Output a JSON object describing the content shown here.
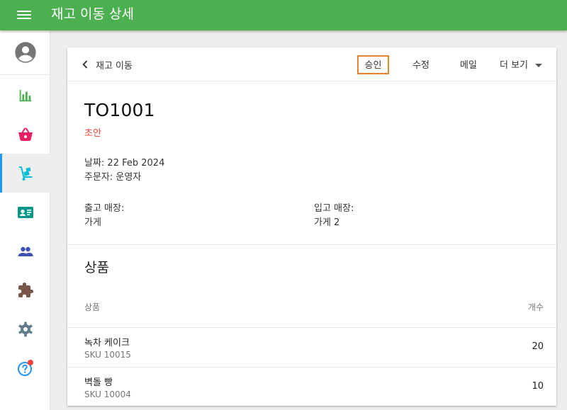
{
  "app_bar": {
    "title": "재고 이동 상세",
    "background": "#4caf50"
  },
  "sidebar": {
    "items": [
      {
        "icon": "bar-chart-icon",
        "color": "#4caf50"
      },
      {
        "icon": "shopping-basket-icon",
        "color": "#e91e63"
      },
      {
        "icon": "hand-truck-icon",
        "color": "#00bcd4",
        "active": true
      },
      {
        "icon": "contact-card-icon",
        "color": "#009688"
      },
      {
        "icon": "people-icon",
        "color": "#3f51b5"
      },
      {
        "icon": "puzzle-icon",
        "color": "#795548"
      },
      {
        "icon": "gear-icon",
        "color": "#607d8b"
      },
      {
        "icon": "help-icon",
        "color": "#2196f3",
        "badge_color": "#f44336"
      }
    ],
    "active_accent": "#2196f3"
  },
  "toolbar": {
    "back_label": "재고 이동",
    "approve_label": "승인",
    "edit_label": "수정",
    "mail_label": "메일",
    "more_label": "더 보기",
    "highlight_color": "#e8822a"
  },
  "transfer": {
    "id": "TO1001",
    "status": "초안",
    "status_color": "#f44336",
    "date_line": "날짜: 22 Feb 2024",
    "orderer_line": "주문자: 운영자",
    "from_store_label": "출고 매장:",
    "from_store_value": "가게",
    "to_store_label": "입고 매장:",
    "to_store_value": "가게 2"
  },
  "products": {
    "section_title": "상품",
    "col_product": "상품",
    "col_qty": "개수",
    "rows": [
      {
        "name": "녹차 케이크",
        "sku": "SKU 10015",
        "qty": "20"
      },
      {
        "name": "벽돌 빵",
        "sku": "SKU 10004",
        "qty": "10"
      }
    ]
  }
}
